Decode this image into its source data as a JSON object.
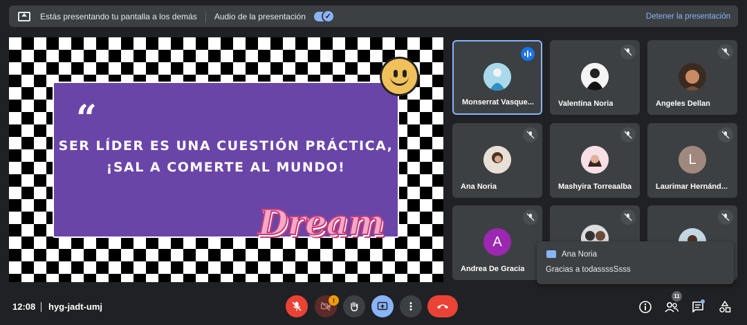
{
  "banner": {
    "presenting_text": "Estás presentando tu pantalla a los demás",
    "audio_label": "Audio de la presentación",
    "audio_checkmark": "✓",
    "stop_label": "Detener la presentación"
  },
  "presentation": {
    "quote_mark": "“",
    "line1": "Ser líder es una cuestión práctica,",
    "line2": "¡Sal a comerte al mundo!",
    "sticker": "Dream"
  },
  "participants": [
    {
      "name": "Monserrat Vasque...",
      "speaking": true
    },
    {
      "name": "Valentina Noria"
    },
    {
      "name": "Angeles Dellan"
    },
    {
      "name": "Ana Noria"
    },
    {
      "name": "Mashyira Torreaalba"
    },
    {
      "name": "Laurimar Hernánd...",
      "initial": "L"
    },
    {
      "name": "Andrea De Gracia",
      "initial": "A"
    },
    {
      "name": ""
    },
    {
      "name": ""
    }
  ],
  "chat_toast": {
    "sender": "Ana Noria",
    "message": "Gracias a todassssSsss"
  },
  "bottom": {
    "time": "12:08",
    "meeting_code": "hyg-jadt-umj",
    "camera_alert": "!",
    "people_count": "11"
  },
  "colors": {
    "accent": "#8ab4f8",
    "end_call": "#ea4335",
    "mic_off": "#ea4335",
    "present_active": "#8ab4f8",
    "background": "#202124",
    "tile": "#3c4043",
    "avatar_L": "#a1887f",
    "avatar_A": "#9c27b0"
  }
}
